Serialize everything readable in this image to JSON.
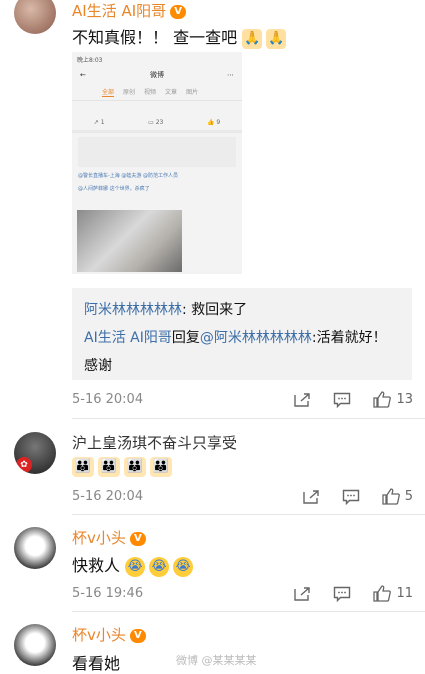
{
  "comments": [
    {
      "username": "AI生活 AI阳哥",
      "vip_badge": "V",
      "text": "不知真假！！ 查一查吧",
      "emojis": [
        "pray",
        "pray"
      ],
      "embedded_screenshot": {
        "status": "晚上8:03",
        "title": "微博",
        "tabs": [
          "全部",
          "原创",
          "视频",
          "文章",
          "图片"
        ],
        "stats": [
          "1",
          "23",
          "9"
        ],
        "mentions": "@警长直播车-上海 @蛙夫游 @防范工作人员",
        "post_text": "@人间萨菲娜 这个世界，杀疯了"
      },
      "replies": [
        {
          "user": "阿米林林林林林",
          "text": ": 救回来了"
        },
        {
          "user": "AI生活 AI阳哥",
          "connector": "回复",
          "mention": "@阿米林林林林林",
          "text": ":活着就好！感谢"
        }
      ],
      "time": "5-16 20:04",
      "likes": "13"
    },
    {
      "username": "沪上皇汤琪不奋斗只享受",
      "text": "",
      "emojis": [
        "family",
        "family",
        "family",
        "family"
      ],
      "time": "5-16 20:04",
      "likes": "5"
    },
    {
      "username": "杯v小头",
      "vip_badge": "V",
      "text": "快救人",
      "emojis": [
        "cry",
        "cry",
        "cry"
      ],
      "time": "5-16 19:46",
      "likes": "11"
    },
    {
      "username": "杯v小头",
      "vip_badge": "V",
      "text": "看看她"
    }
  ],
  "watermark": "微博 @某某某某",
  "colors": {
    "orange": "#e8862a",
    "blue": "#3c6ea8",
    "reply_bg": "#f2f2f2"
  },
  "icons": [
    "share-icon",
    "comment-icon",
    "like-icon"
  ]
}
